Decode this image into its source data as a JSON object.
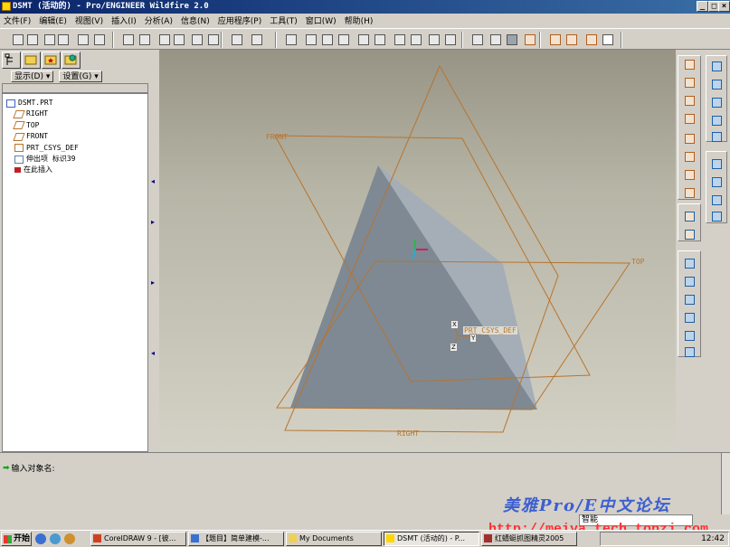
{
  "window": {
    "title": "DSMT (活动的) - Pro/ENGINEER Wildfire 2.0",
    "min_label": "_",
    "max_label": "□",
    "close_label": "×"
  },
  "menubar": [
    "文件(F)",
    "编辑(E)",
    "视图(V)",
    "插入(I)",
    "分析(A)",
    "信息(N)",
    "应用程序(P)",
    "工具(T)",
    "窗口(W)",
    "帮助(H)"
  ],
  "nav": {
    "show_button": "显示(D) ▾",
    "settings_button": "设置(G) ▾"
  },
  "model_tree": [
    {
      "label": "DSMT.PRT",
      "icon": "part-icon",
      "indent": 0
    },
    {
      "label": "RIGHT",
      "icon": "datum-plane-icon",
      "indent": 1
    },
    {
      "label": "TOP",
      "icon": "datum-plane-icon",
      "indent": 1
    },
    {
      "label": "FRONT",
      "icon": "datum-plane-icon",
      "indent": 1
    },
    {
      "label": "PRT_CSYS_DEF",
      "icon": "csys-icon",
      "indent": 1
    },
    {
      "label": "伸出项 标识39",
      "icon": "protrusion-icon",
      "indent": 1
    },
    {
      "label": "在此插入",
      "icon": "insert-here-arrow-icon",
      "indent": 1
    }
  ],
  "viewport": {
    "labels": {
      "front": "FRONT",
      "top": "TOP",
      "right": "RIGHT",
      "csys": "PRT_CSYS_DEF",
      "x": "X",
      "y": "Y",
      "z": "Z"
    },
    "colors": {
      "datum": "#b8742e",
      "solid_dark": "#7f8a94",
      "solid_light": "#a9b2bb",
      "background": "#b7b5a6"
    }
  },
  "message": {
    "prompt": "输入对象名:"
  },
  "status": {
    "watermark": "美雅Pro/E中文论坛",
    "url": "http://meiya.tech.topzj.com",
    "filter_value": "智能"
  },
  "taskbar": {
    "start": "开始",
    "tasks": [
      "CorelDRAW 9 - [彼...",
      "【题目】简单建模-...",
      "My Documents",
      "DSMT (活动的) - P...",
      "红蜻蜓抓图精灵2005"
    ],
    "clock": "12:42"
  },
  "toolbar_icons": [
    "new-icon",
    "open-icon",
    "save-icon",
    "print-icon",
    "email-icon",
    "undo-icon",
    "redo-icon",
    "cut-icon",
    "copy-icon",
    "paste-icon",
    "regenerate-icon",
    "find-icon",
    "select-box-icon",
    "repaint-icon",
    "spin-center-icon",
    "orient-icon",
    "zoom-in-icon",
    "zoom-out-icon",
    "refit-icon",
    "reorient-icon",
    "saved-views-icon",
    "layers-icon",
    "view-manager-icon",
    "wireframe-icon",
    "hidden-line-icon",
    "no-hidden-icon",
    "shading-icon",
    "datum-planes-icon",
    "datum-axes-icon",
    "datum-points-icon",
    "csys-display-icon",
    "context-help-icon"
  ]
}
